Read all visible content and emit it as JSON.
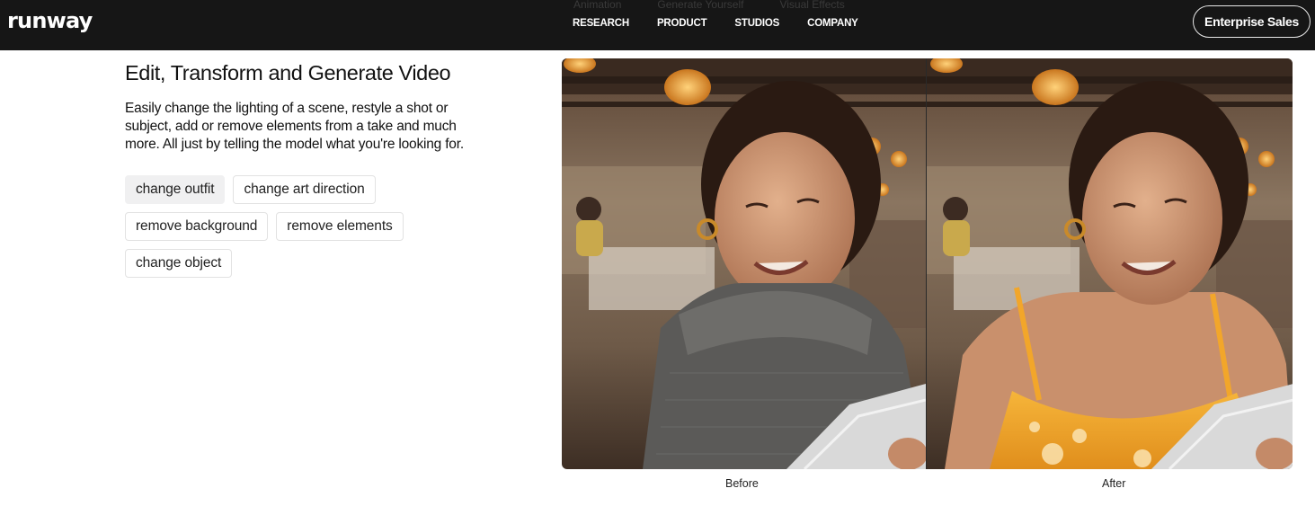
{
  "header": {
    "logo": "runway",
    "nav": [
      "RESEARCH",
      "PRODUCT",
      "STUDIOS",
      "COMPANY"
    ],
    "ghost_nav": [
      "Animation",
      "Generate Yourself",
      "Visual Effects"
    ],
    "cta": "Enterprise Sales"
  },
  "main": {
    "title": "Edit, Transform and Generate Video",
    "description": "Easily change the lighting of a scene, restyle a shot or subject, add or remove elements from a take and much more. All just by telling the model what you're looking for.",
    "chips": [
      "change outfit",
      "change art direction",
      "remove background",
      "remove elements",
      "change object"
    ],
    "active_chip": "change outfit"
  },
  "comparison": {
    "before_label": "Before",
    "after_label": "After",
    "before_outfit_color": "#5b5a58",
    "after_outfit_color": "#f2a62a"
  },
  "colors": {
    "header_bg": "#161616",
    "chip_active_bg": "#f0f0f1"
  }
}
